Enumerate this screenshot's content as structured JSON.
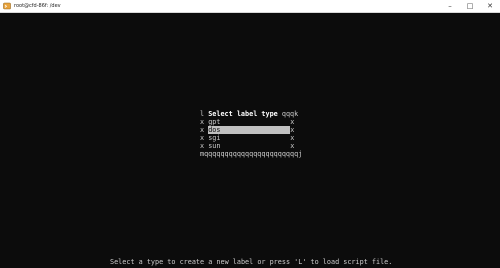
{
  "window": {
    "title": "root@cfd-86f: /dev",
    "minimize_glyph": "–",
    "maximize_glyph": "□",
    "close_glyph": "✕",
    "app_icon": "terminal-app-icon"
  },
  "dialog": {
    "title_left": "l",
    "title": "Select label type",
    "title_right": "qqqk",
    "side_char": "x",
    "bottom_border": "mqqqqqqqqqqqqqqqqqqqqqqqj",
    "options": [
      "gpt",
      "dos",
      "sgi",
      "sun"
    ],
    "selected_option": "dos"
  },
  "status": {
    "message": "Select a type to create a new label or press 'L' to load script file."
  },
  "colors": {
    "background": "#0c0c0c",
    "text": "#cccccc",
    "highlight": "#c0c0c0"
  }
}
